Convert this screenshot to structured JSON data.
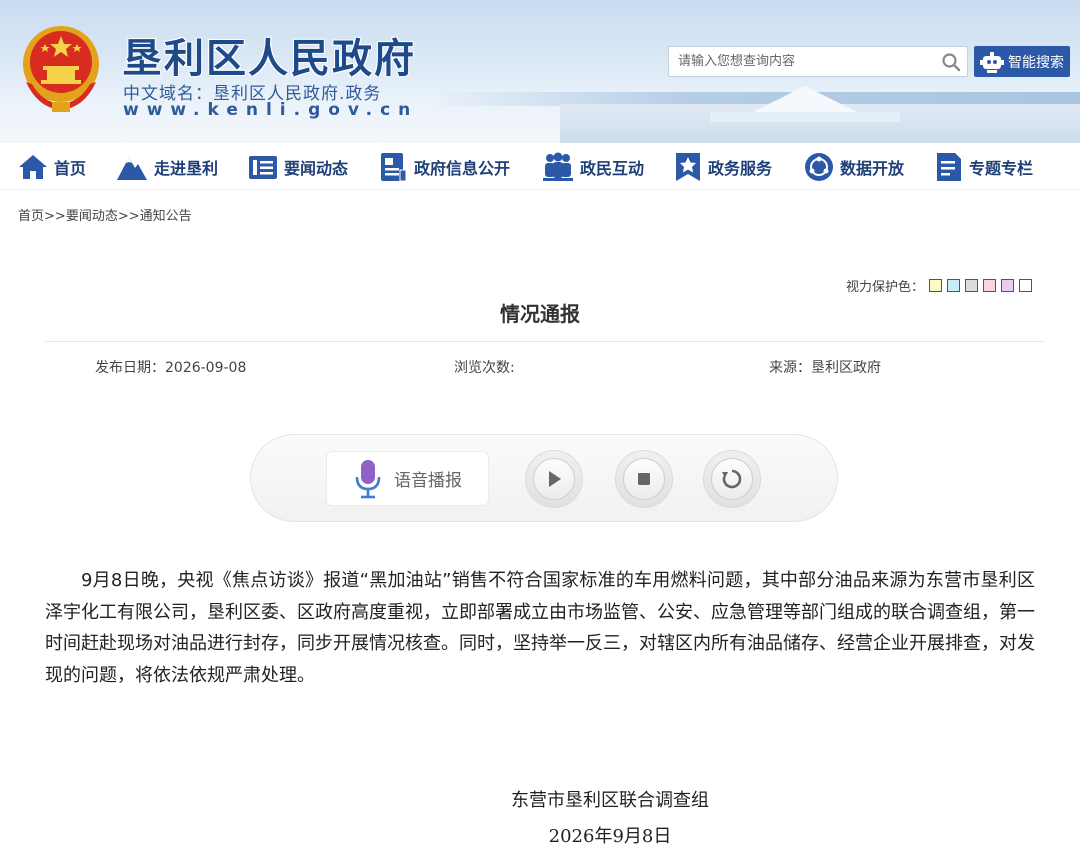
{
  "header": {
    "site_title": "垦利区人民政府",
    "domain_line": "中文域名：垦利区人民政府.政务",
    "url_line": "www.kenli.gov.cn",
    "search_placeholder": "请输入您想查询内容",
    "smart_search_label": "智能搜索"
  },
  "nav": {
    "items": [
      {
        "label": "首页",
        "icon": "home-icon"
      },
      {
        "label": "走进垦利",
        "icon": "mountain-icon"
      },
      {
        "label": "要闻动态",
        "icon": "news-list-icon"
      },
      {
        "label": "政府信息公开",
        "icon": "document-icon"
      },
      {
        "label": "政民互动",
        "icon": "people-icon"
      },
      {
        "label": "政务服务",
        "icon": "star-bookmark-icon"
      },
      {
        "label": "数据开放",
        "icon": "data-network-icon"
      },
      {
        "label": "专题专栏",
        "icon": "column-doc-icon"
      }
    ]
  },
  "breadcrumb": {
    "items": [
      "首页",
      "要闻动态",
      "通知公告"
    ],
    "separator": ">>"
  },
  "eye_care": {
    "label": "视力保护色：",
    "colors": [
      "#fafac4",
      "#c8ebf5",
      "#dcdcdc",
      "#f9d5dc",
      "#e6cdf1",
      "#ffffff"
    ]
  },
  "article": {
    "title": "情况通报",
    "publish_date_label": "发布日期：",
    "publish_date": "2026-09-08",
    "views_label": "浏览次数:",
    "source_label": "来源：",
    "source": "垦利区政府",
    "body": "9月8日晚，央视《焦点访谈》报道“黑加油站”销售不符合国家标准的车用燃料问题，其中部分油品来源为东营市垦利区泽宇化工有限公司，垦利区委、区政府高度重视，立即部署成立由市场监管、公安、应急管理等部门组成的联合调查组，第一时间赶赴现场对油品进行封存，同步开展情况核查。同时，坚持举一反三，对辖区内所有油品储存、经营企业开展排查，对发现的问题，将依法依规严肃处理。",
    "signature_org": "东营市垦利区联合调查组",
    "signature_date": "2026年9月8日"
  },
  "player": {
    "label": "语音播报"
  },
  "colors": {
    "brand_blue": "#1e4a8a",
    "nav_text": "#1f3f78",
    "button_blue": "#2b59a8"
  }
}
